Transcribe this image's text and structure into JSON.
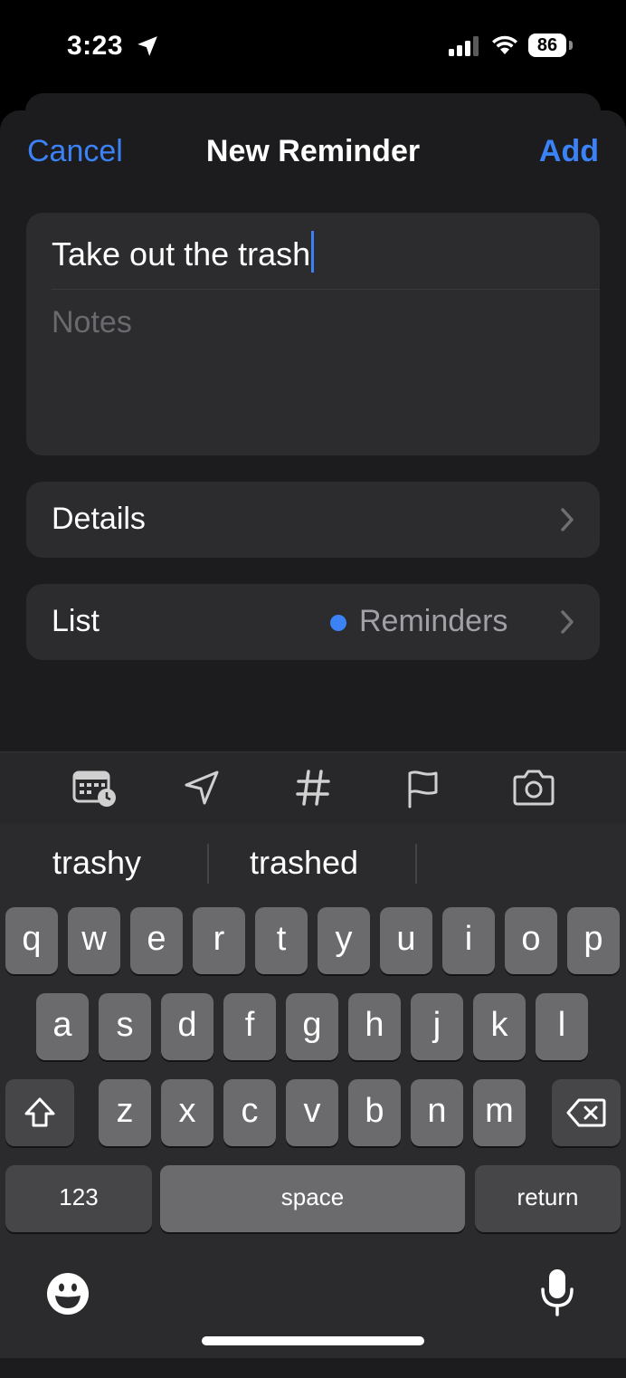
{
  "status": {
    "time": "3:23",
    "battery": "86"
  },
  "nav": {
    "cancel": "Cancel",
    "title": "New Reminder",
    "add": "Add"
  },
  "reminder": {
    "title": "Take out the trash",
    "notes_placeholder": "Notes"
  },
  "details": {
    "label": "Details"
  },
  "list": {
    "label": "List",
    "value": "Reminders",
    "dot_color": "#3b82f6"
  },
  "toolbar": {
    "icons": [
      "date-time-icon",
      "location-icon",
      "tag-icon",
      "flag-icon",
      "camera-icon"
    ]
  },
  "suggestions": [
    "trashy",
    "trashed"
  ],
  "keys": {
    "row1": [
      "q",
      "w",
      "e",
      "r",
      "t",
      "y",
      "u",
      "i",
      "o",
      "p"
    ],
    "row2": [
      "a",
      "s",
      "d",
      "f",
      "g",
      "h",
      "j",
      "k",
      "l"
    ],
    "row3": [
      "z",
      "x",
      "c",
      "v",
      "b",
      "n",
      "m"
    ],
    "numbers": "123",
    "space": "space",
    "return": "return"
  },
  "colors": {
    "accent": "#3b82f6",
    "background": "#1c1c1e",
    "card": "#2c2c2e"
  }
}
